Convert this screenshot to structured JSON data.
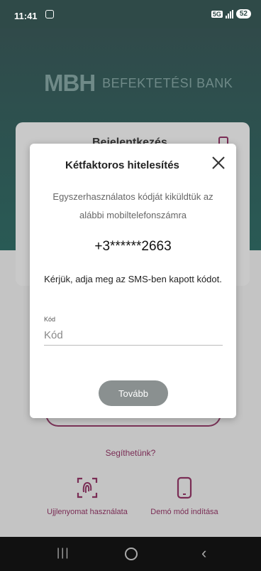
{
  "status_bar": {
    "time": "11:41",
    "network": "5G",
    "battery": "52"
  },
  "brand": {
    "mark": "MBH",
    "name": "BEFEKTETÉSI BANK"
  },
  "background_card": {
    "title": "Bejelentkezés"
  },
  "modal": {
    "title": "Kétfaktoros hitelesítés",
    "description": "Egyszerhasználatos kódját kiküldtük az alábbi mobiltelefonszámra",
    "phone": "+3******2663",
    "instruction": "Kérjük, adja meg az SMS-ben kapott kódot.",
    "field_label": "Kód",
    "field_placeholder": "Kód",
    "field_value": "",
    "next_label": "Tovább"
  },
  "help_link": "Segíthetünk?",
  "actions": {
    "fingerprint_label": "Ujjlenyomat használata",
    "demo_label": "Demó mód indítása"
  },
  "colors": {
    "accent": "#7a2d55",
    "header": "#2f4a48",
    "button": "#8a9090"
  },
  "icons": [
    "notification-icon",
    "signal-icon",
    "battery-icon",
    "account-icon",
    "close-icon",
    "fingerprint-icon",
    "phone-icon",
    "recent-apps-icon",
    "home-icon",
    "back-icon"
  ]
}
